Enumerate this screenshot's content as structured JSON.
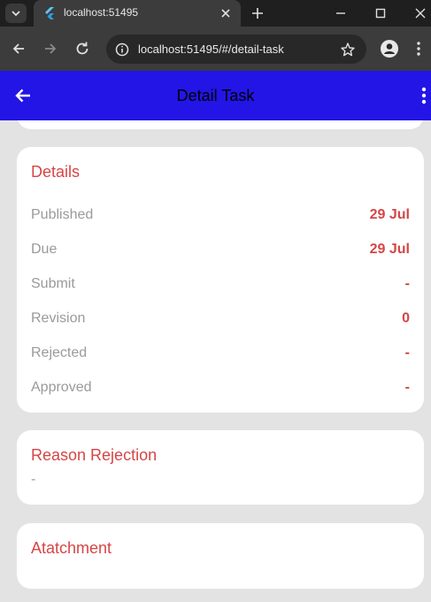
{
  "browser": {
    "tab_title": "localhost:51495",
    "url": "localhost:51495/#/detail-task"
  },
  "appbar": {
    "title": "Detail Task"
  },
  "details": {
    "title": "Details",
    "rows": [
      {
        "label": "Published",
        "value": "29 Jul"
      },
      {
        "label": "Due",
        "value": "29 Jul"
      },
      {
        "label": "Submit",
        "value": "-"
      },
      {
        "label": "Revision",
        "value": "0"
      },
      {
        "label": "Rejected",
        "value": "-"
      },
      {
        "label": "Approved",
        "value": "-"
      }
    ]
  },
  "reason": {
    "title": "Reason Rejection",
    "text": "-"
  },
  "attachment": {
    "title": "Atatchment"
  },
  "colors": {
    "appbar": "#2215e6",
    "accent": "#d64545"
  }
}
